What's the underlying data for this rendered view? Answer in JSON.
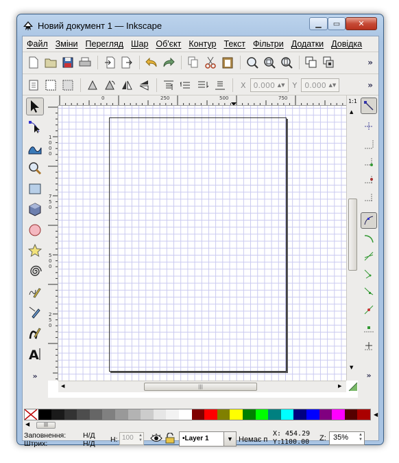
{
  "window": {
    "title": "Новий документ 1 — Inkscape",
    "min_glyph": "▁",
    "max_glyph": "▭",
    "close_glyph": "✕"
  },
  "menu": [
    "Файл",
    "Зміни",
    "Перегляд",
    "Шар",
    "Об'єкт",
    "Контур",
    "Текст",
    "Фільтри",
    "Додатки",
    "Довідка"
  ],
  "toolbar1": {
    "more_label": "»",
    "icons": [
      "new-icon",
      "open-icon",
      "save-icon",
      "print-icon",
      "import-icon",
      "export-icon",
      "undo-icon",
      "redo-icon",
      "copy-icon",
      "cut-icon",
      "paste-icon",
      "zoom-selection-icon",
      "zoom-drawing-icon",
      "zoom-page-icon",
      "duplicate-icon",
      "clone-icon"
    ]
  },
  "toolbar2": {
    "x_label": "X",
    "x_value": "0.000",
    "y_label": "Y",
    "y_value": "0.000",
    "more_label": "»"
  },
  "rulers": {
    "h_labels": [
      "0",
      "250",
      "500",
      "750"
    ],
    "v_labels": [
      "1000",
      "750",
      "500",
      "250"
    ],
    "zoom_corner": "1:1"
  },
  "scrollbar_grip": "|||",
  "toolbox_more": "»",
  "snap_more": "»",
  "palette": [
    "#000000",
    "#1a1a1a",
    "#333333",
    "#4d4d4d",
    "#666666",
    "#808080",
    "#999999",
    "#b3b3b3",
    "#cccccc",
    "#e6e6e6",
    "#f2f2f2",
    "#ffffff",
    "#800000",
    "#ff0000",
    "#808000",
    "#ffff00",
    "#008000",
    "#00ff00",
    "#008080",
    "#00ffff",
    "#000080",
    "#0000ff",
    "#800080",
    "#ff00ff",
    "#550000",
    "#aa0000"
  ],
  "status": {
    "fill_label": "Заповнення:",
    "fill_value": "Н/Д",
    "stroke_label": "Штрих:",
    "stroke_value": "Н/Д",
    "h_label": "H:",
    "h_value": "100",
    "layer_name": "•Layer 1",
    "message": "Немає п",
    "x_label": "X:",
    "x_value": "454.29",
    "y_label": "Y:",
    "y_value": "1100.00",
    "z_label": "Z:",
    "zoom_value": "35%"
  }
}
